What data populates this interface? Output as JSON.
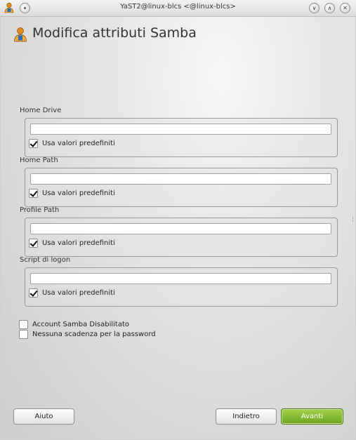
{
  "window": {
    "title": "YaST2@linux-blcs <@linux-blcs>"
  },
  "page": {
    "title": "Modifica attributi Samba"
  },
  "groups": [
    {
      "label": "Home Drive",
      "value": "",
      "default_label": "Usa valori predefiniti",
      "use_default": true
    },
    {
      "label": "Home Path",
      "value": "",
      "default_label": "Usa valori predefiniti",
      "use_default": true
    },
    {
      "label": "Profile Path",
      "value": "",
      "default_label": "Usa valori predefiniti",
      "use_default": true
    },
    {
      "label": "Script di logon",
      "value": "",
      "default_label": "Usa valori predefiniti",
      "use_default": true
    }
  ],
  "options": {
    "account_disabled": {
      "label": "Account Samba Disabilitato",
      "checked": false
    },
    "no_password_expiry": {
      "label": "Nessuna scadenza per la password",
      "checked": false
    }
  },
  "buttons": {
    "help": "Aiuto",
    "back": "Indietro",
    "next": "Avanti"
  },
  "icons": {
    "app": "yast-user-icon",
    "title_controls": [
      "minimize-icon",
      "maximize-icon",
      "close-icon"
    ]
  },
  "colors": {
    "next_button": "#7ab52b",
    "title_text": "#333333"
  }
}
